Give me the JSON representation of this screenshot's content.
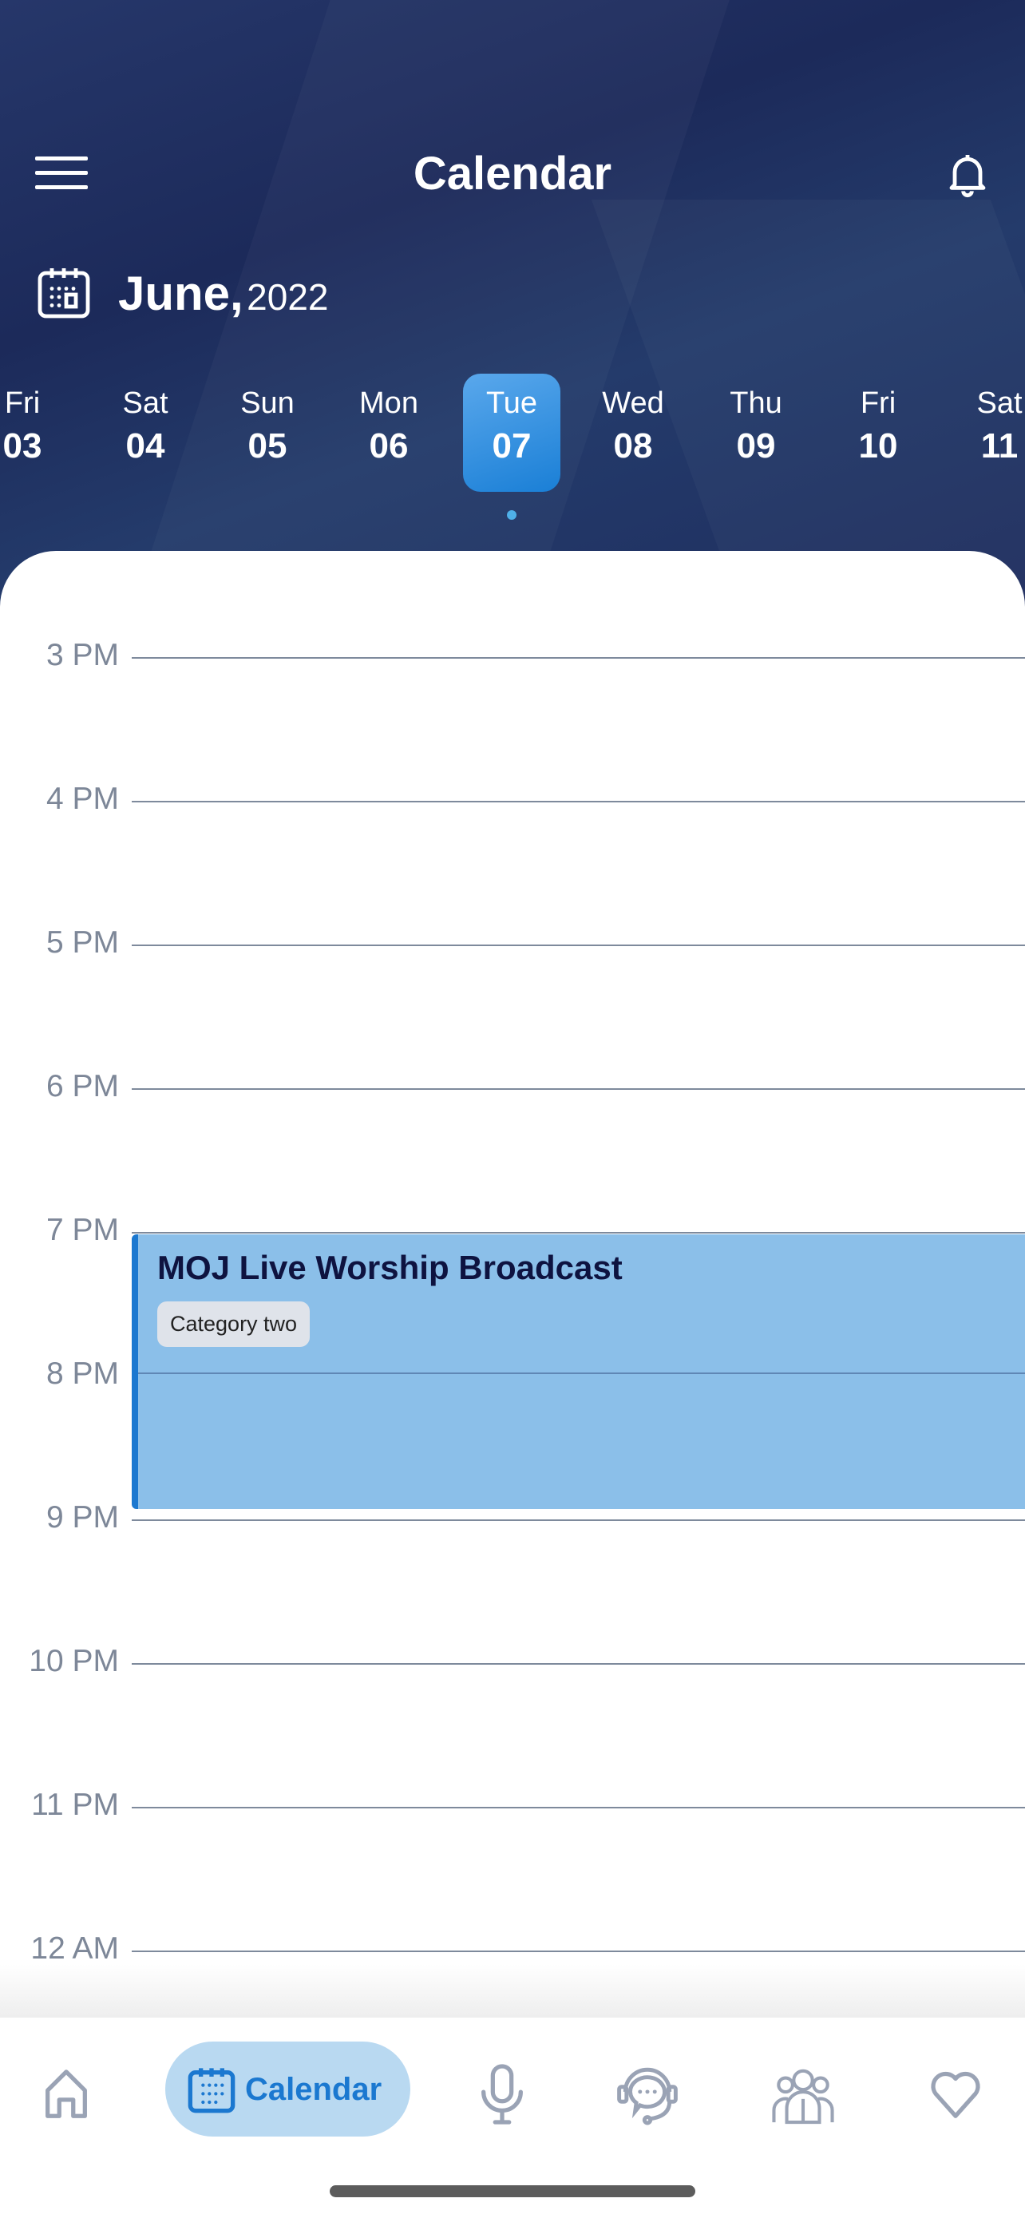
{
  "header": {
    "title": "Calendar",
    "month": "June,",
    "year": "2022"
  },
  "days": [
    {
      "name": "Fri",
      "date": "03"
    },
    {
      "name": "Sat",
      "date": "04"
    },
    {
      "name": "Sun",
      "date": "05"
    },
    {
      "name": "Mon",
      "date": "06"
    },
    {
      "name": "Tue",
      "date": "07",
      "selected": true
    },
    {
      "name": "Wed",
      "date": "08"
    },
    {
      "name": "Thu",
      "date": "09"
    },
    {
      "name": "Fri",
      "date": "10"
    },
    {
      "name": "Sat",
      "date": "11"
    }
  ],
  "hours": [
    "3 PM",
    "4 PM",
    "5 PM",
    "6 PM",
    "7 PM",
    "8 PM",
    "9 PM",
    "10 PM",
    "11 PM",
    "12 AM"
  ],
  "event": {
    "title": "MOJ Live Worship Broadcast",
    "category": "Category two",
    "start": "7 PM",
    "end": "9 PM",
    "color": "#8bbfe9",
    "accent": "#1b78d0"
  },
  "nav": {
    "items": [
      {
        "icon": "home-icon"
      },
      {
        "icon": "calendar-icon",
        "label": "Calendar",
        "active": true
      },
      {
        "icon": "microphone-icon"
      },
      {
        "icon": "headset-chat-icon"
      },
      {
        "icon": "team-icon"
      },
      {
        "icon": "heart-icon"
      }
    ]
  },
  "colors": {
    "header_bg": "#1f2f60",
    "accent": "#1b78d0",
    "nav_inactive": "#9aa3b5"
  }
}
